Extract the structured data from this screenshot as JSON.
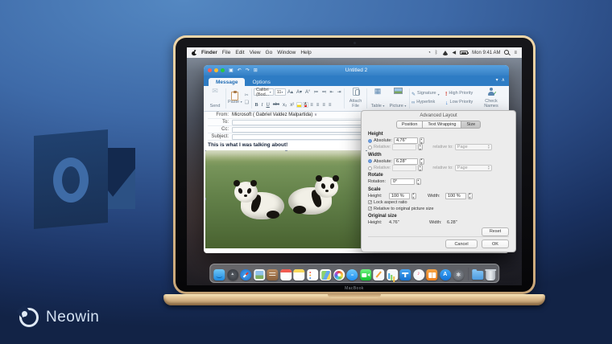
{
  "branding": {
    "neowin_label": "Neowin",
    "macbook_label": "MacBook"
  },
  "menu_bar": {
    "menus": [
      "Finder",
      "File",
      "Edit",
      "View",
      "Go",
      "Window",
      "Help"
    ],
    "clock": "Mon 9:41 AM"
  },
  "mail_window": {
    "title": "Untitled 2",
    "tabs": [
      "Message",
      "Options"
    ],
    "ribbon": {
      "send": "Send",
      "paste": "Paste",
      "font_name": "Calibri (Bod...",
      "font_size": "11",
      "attach_file": "Attach File",
      "table": "Table",
      "picture": "Picture",
      "signature": "Signature",
      "hyperlink": "Hyperlink",
      "high_priority": "High Priority",
      "low_priority": "Low Priority",
      "check_names": "Check Names"
    },
    "fields": {
      "from_label": "From:",
      "from_value": "Microsoft ( Gabriel Valdez Malpartida)",
      "to_label": "To:",
      "to_value": "",
      "cc_label": "Cc:",
      "cc_value": "",
      "subject_label": "Subject:",
      "subject_value": ""
    },
    "body_text": "This is what I was talking about!"
  },
  "dialog": {
    "title": "Advanced Layout",
    "tabs": [
      "Position",
      "Text Wrapping",
      "Size"
    ],
    "active_tab": "Size",
    "height_section": {
      "heading": "Height",
      "absolute_label": "Absolute:",
      "absolute_value": "4.76\"",
      "relative_label": "Relative:",
      "relative_to_label": "relative to:",
      "relative_to_value": "Page"
    },
    "width_section": {
      "heading": "Width",
      "absolute_label": "Absolute:",
      "absolute_value": "6.28\"",
      "relative_label": "Relative:",
      "relative_to_label": "relative to:",
      "relative_to_value": "Page"
    },
    "rotate_section": {
      "heading": "Rotate",
      "rotation_label": "Rotation:",
      "rotation_value": "0°"
    },
    "scale_section": {
      "heading": "Scale",
      "height_label": "Height:",
      "height_value": "100 %",
      "width_label": "Width:",
      "width_value": "100 %",
      "lock_aspect": "Lock aspect ratio",
      "relative_original": "Relative to original picture size",
      "lock_aspect_checked": "✓",
      "relative_original_checked": "✓"
    },
    "original_section": {
      "heading": "Original size",
      "height_label": "Height:",
      "height_value": "4.76\"",
      "width_label": "Width:",
      "width_value": "6.28\""
    },
    "buttons": {
      "reset": "Reset",
      "cancel": "Cancel",
      "ok": "OK"
    }
  },
  "dock": {
    "apps": [
      "finder",
      "launchpad",
      "safari",
      "preview",
      "contacts",
      "calendar",
      "notes",
      "reminders",
      "maps",
      "photos",
      "messages",
      "facetime",
      "pages",
      "numbers",
      "keynote",
      "itunes",
      "ibooks",
      "app-store",
      "system-preferences",
      "downloads",
      "trash"
    ]
  },
  "colors": {
    "outlook_titlebar": "#3580c6",
    "outlook_tab_row": "#2e7cc4",
    "outlook_logo_navy": "#1d3a66",
    "outlook_logo_o": "#3e6ba6",
    "dialog_bg": "#ececec",
    "macbook_gold": "#d9b98c",
    "grass_green": "#5f7d42",
    "background_top": "#5488c2",
    "background_bottom": "#122346"
  }
}
